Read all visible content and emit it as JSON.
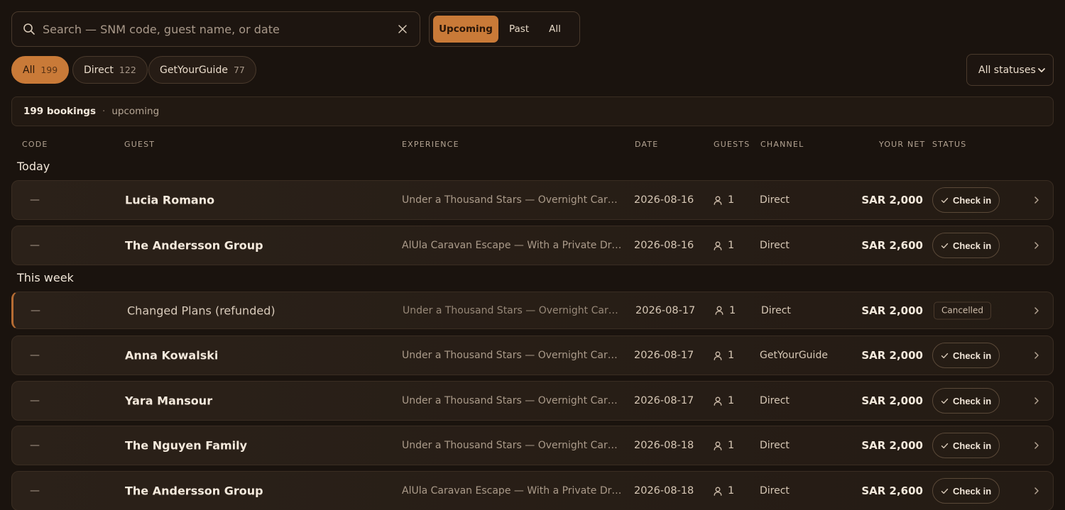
{
  "search": {
    "placeholder": "Search — SNM code, guest name, or date",
    "value": ""
  },
  "time_filter": {
    "options": [
      "Upcoming",
      "Past",
      "All"
    ],
    "selected": "Upcoming"
  },
  "channel_filters": [
    {
      "label": "All",
      "count": "199",
      "active": true
    },
    {
      "label": "Direct",
      "count": "122",
      "active": false
    },
    {
      "label": "GetYourGuide",
      "count": "77",
      "active": false
    }
  ],
  "status_filter": {
    "selected": "All statuses"
  },
  "summary": {
    "count": "199 bookings",
    "separator": "·",
    "period": "upcoming"
  },
  "columns": [
    "CODE",
    "GUEST",
    "EXPERIENCE",
    "DATE",
    "GUESTS",
    "CHANNEL",
    "YOUR NET",
    "STATUS"
  ],
  "groups": [
    {
      "label": "Today",
      "rows": [
        {
          "code": "—",
          "guest": "Lucia Romano",
          "experience": "Under a Thousand Stars — Overnight Caravan Experience",
          "date": "2026-08-16",
          "guests": "1",
          "channel": "Direct",
          "net": "SAR 2,000",
          "status": "Check in",
          "status_type": "checkin"
        },
        {
          "code": "—",
          "guest": "The Andersson Group",
          "experience": "AlUla Caravan Escape — With a Private Driver",
          "date": "2026-08-16",
          "guests": "1",
          "channel": "Direct",
          "net": "SAR 2,600",
          "status": "Check in",
          "status_type": "checkin"
        }
      ]
    },
    {
      "label": "This week",
      "rows": [
        {
          "code": "—",
          "guest": "Changed Plans (refunded)",
          "experience": "Under a Thousand Stars — Overnight Caravan Experience",
          "date": "2026-08-17",
          "guests": "1",
          "channel": "Direct",
          "net": "SAR 2,000",
          "status": "Cancelled",
          "status_type": "cancelled"
        },
        {
          "code": "—",
          "guest": "Anna Kowalski",
          "experience": "Under a Thousand Stars — Overnight Caravan Experience",
          "date": "2026-08-17",
          "guests": "1",
          "channel": "GetYourGuide",
          "net": "SAR 2,000",
          "status": "Check in",
          "status_type": "checkin"
        },
        {
          "code": "—",
          "guest": "Yara Mansour",
          "experience": "Under a Thousand Stars — Overnight Caravan Experience",
          "date": "2026-08-17",
          "guests": "1",
          "channel": "Direct",
          "net": "SAR 2,000",
          "status": "Check in",
          "status_type": "checkin"
        },
        {
          "code": "—",
          "guest": "The Nguyen Family",
          "experience": "Under a Thousand Stars — Overnight Caravan Experience",
          "date": "2026-08-18",
          "guests": "1",
          "channel": "Direct",
          "net": "SAR 2,000",
          "status": "Check in",
          "status_type": "checkin"
        },
        {
          "code": "—",
          "guest": "The Andersson Group",
          "experience": "AlUla Caravan Escape — With a Private Driver",
          "date": "2026-08-18",
          "guests": "1",
          "channel": "Direct",
          "net": "SAR 2,600",
          "status": "Check in",
          "status_type": "checkin"
        }
      ]
    }
  ],
  "colors": {
    "accent": "#c97a38",
    "background": "#1a130e",
    "row": "#2b2119"
  }
}
